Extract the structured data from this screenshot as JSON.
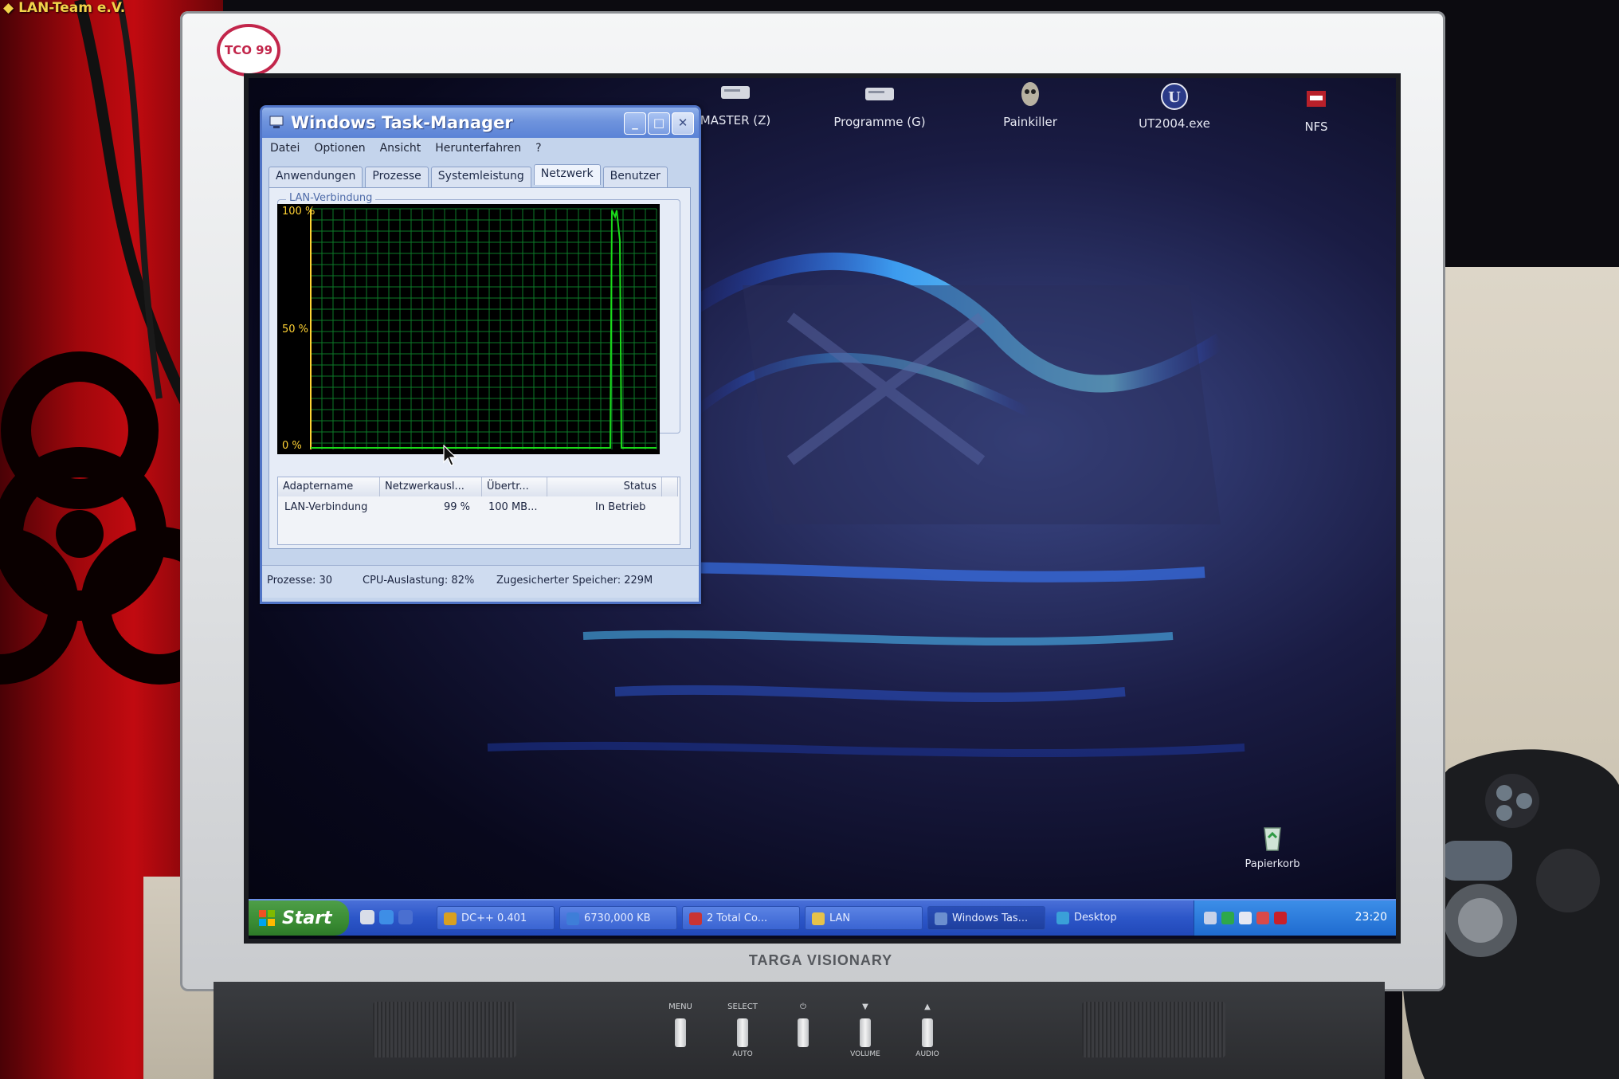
{
  "watermark": "LAN-Team e.V.",
  "monitor": {
    "tco_badge": "TCO 99",
    "brand": "TARGA VISIONARY",
    "buttons": [
      {
        "label": "MENU",
        "sub": ""
      },
      {
        "label": "SELECT",
        "sub": "AUTO"
      },
      {
        "label": "⏻",
        "sub": ""
      },
      {
        "label": "▼",
        "sub": "VOLUME"
      },
      {
        "label": "▲",
        "sub": "AUDIO"
      }
    ]
  },
  "desktop": {
    "icons": [
      {
        "label": "MASTER (Z)",
        "icon": "network-drive-icon"
      },
      {
        "label": "Programme (G)",
        "icon": "network-drive-icon"
      },
      {
        "label": "Painkiller",
        "icon": "game-icon"
      },
      {
        "label": "UT2004.exe",
        "icon": "game-icon"
      },
      {
        "label": "NFS",
        "icon": "game-icon"
      },
      {
        "label": "Papierkorb",
        "icon": "recycle-bin-icon"
      }
    ]
  },
  "task_manager": {
    "title": "Windows Task-Manager",
    "menu": [
      "Datei",
      "Optionen",
      "Ansicht",
      "Herunterfahren",
      "?"
    ],
    "tabs": [
      {
        "label": "Anwendungen",
        "active": false
      },
      {
        "label": "Prozesse",
        "active": false
      },
      {
        "label": "Systemleistung",
        "active": false
      },
      {
        "label": "Netzwerk",
        "active": true
      },
      {
        "label": "Benutzer",
        "active": false
      }
    ],
    "group_label": "LAN-Verbindung",
    "graph": {
      "y_labels": [
        "100 %",
        "50 %",
        "0 %"
      ],
      "line_color": "#1ad91a",
      "grid_color": "#0c7a28",
      "axis_color": "#ffd234"
    },
    "table": {
      "headers": [
        "Adaptername",
        "Netzwerkausl...",
        "Übertr...",
        "Status"
      ],
      "rows": [
        {
          "name": "LAN-Verbindung",
          "utilization": "99 %",
          "speed": "100 MB...",
          "status": "In Betrieb"
        }
      ]
    },
    "status": {
      "processes": "Prozesse: 30",
      "cpu": "CPU-Auslastung: 82%",
      "memory": "Zugesicherter Speicher: 229M"
    }
  },
  "taskbar": {
    "start_label": "Start",
    "buttons": [
      {
        "label": "DC++ 0.401",
        "color": "#d9a020"
      },
      {
        "label": "6730,000 KB",
        "color": "#3e7ed8"
      },
      {
        "label": "2 Total Co...",
        "color": "#c83434"
      },
      {
        "label": "LAN",
        "color": "#e6c24a"
      },
      {
        "label": "Windows Tas...",
        "color": "#6b8fcf"
      },
      {
        "label": "Desktop",
        "color": "#3aa0d8"
      }
    ],
    "clock": "23:20"
  }
}
